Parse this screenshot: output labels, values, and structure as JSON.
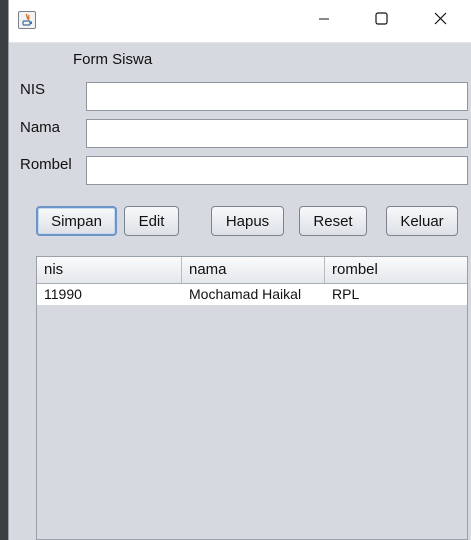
{
  "window": {
    "controls": {
      "minimize_icon": "minimize-icon",
      "maximize_icon": "maximize-icon",
      "close_icon": "close-icon"
    }
  },
  "form": {
    "title": "Form Siswa",
    "fields": [
      {
        "label": "NIS",
        "value": ""
      },
      {
        "label": "Nama",
        "value": ""
      },
      {
        "label": "Rombel",
        "value": ""
      }
    ]
  },
  "buttons": {
    "simpan": "Simpan",
    "edit": "Edit",
    "hapus": "Hapus",
    "reset": "Reset",
    "keluar": "Keluar"
  },
  "table": {
    "columns": [
      "nis",
      "nama",
      "rombel"
    ],
    "rows": [
      [
        "11990",
        "Mochamad Haikal",
        "RPL"
      ]
    ]
  }
}
